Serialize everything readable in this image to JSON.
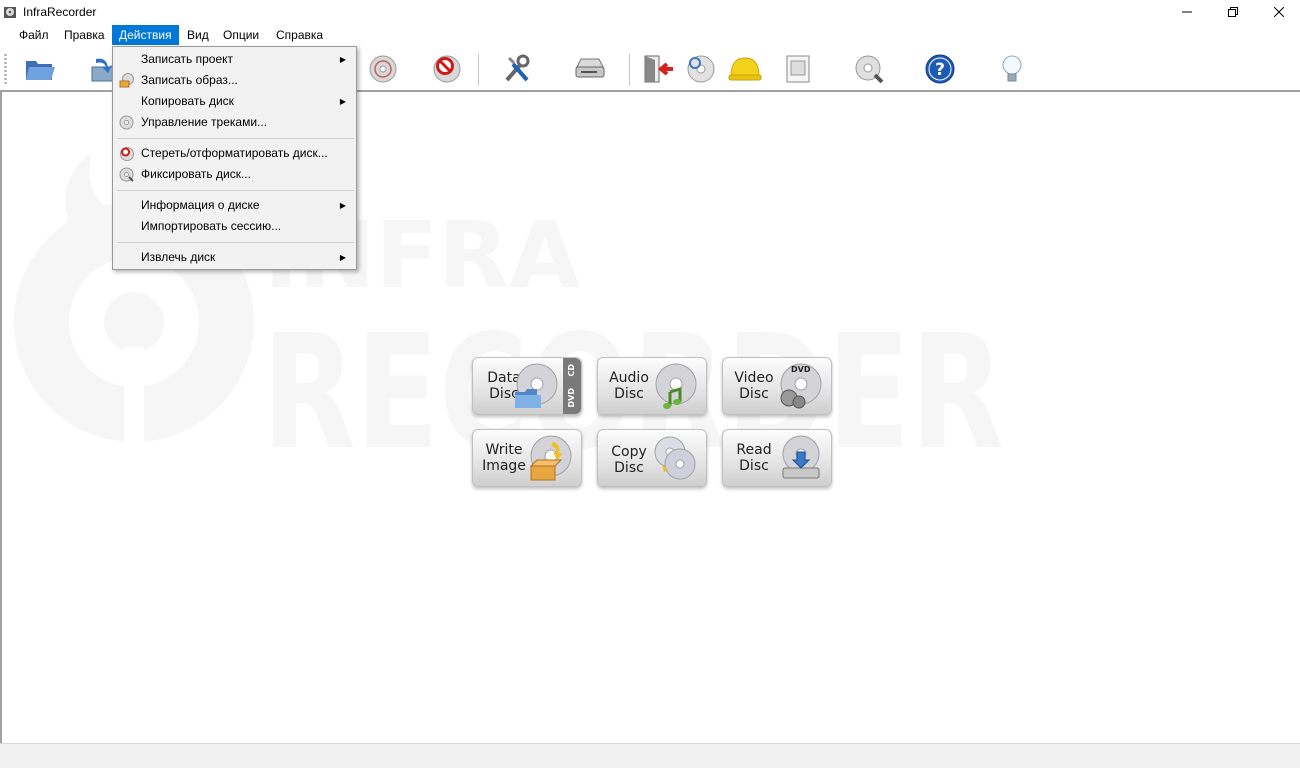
{
  "window": {
    "title": "InfraRecorder",
    "controls": {
      "minimize": "—",
      "maximize": "❐",
      "close": "✕"
    }
  },
  "menubar": {
    "items": [
      {
        "label": "Файл"
      },
      {
        "label": "Правка"
      },
      {
        "label": "Действия"
      },
      {
        "label": "Вид"
      },
      {
        "label": "Опции"
      },
      {
        "label": "Справка"
      }
    ],
    "active_index": 2
  },
  "toolbar": {
    "buttons": [
      {
        "icon": "open-folder-icon"
      },
      {
        "icon": "save-icon"
      },
      {
        "icon": "manage-tracks-icon"
      },
      {
        "icon": "erase-disc-icon"
      },
      {
        "icon": "tools-icon"
      },
      {
        "icon": "drive-icon"
      },
      {
        "icon": "exit-icon"
      },
      {
        "icon": "disc-info-icon"
      },
      {
        "icon": "project-icon"
      },
      {
        "icon": "log-icon"
      },
      {
        "icon": "disc-search-icon"
      },
      {
        "icon": "help-icon"
      },
      {
        "icon": "tip-icon"
      }
    ]
  },
  "actions_menu": {
    "items": [
      {
        "label": "Записать проект",
        "submenu": true,
        "icon": ""
      },
      {
        "label": "Записать образ...",
        "submenu": false,
        "icon": "write-image-icon"
      },
      {
        "label": "Копировать диск",
        "submenu": true,
        "icon": ""
      },
      {
        "label": "Управление треками...",
        "submenu": false,
        "icon": "tracks-icon"
      },
      {
        "label": "Стереть/отформатировать диск...",
        "submenu": false,
        "icon": "erase-icon"
      },
      {
        "label": "Фиксировать диск...",
        "submenu": false,
        "icon": "fixate-icon"
      },
      {
        "label": "Информация о диске",
        "submenu": true,
        "icon": ""
      },
      {
        "label": "Импортировать сессию...",
        "submenu": false,
        "icon": ""
      },
      {
        "label": "Извлечь диск",
        "submenu": true,
        "icon": ""
      }
    ],
    "submenu_arrow": "▶"
  },
  "launcher": {
    "data_disc": {
      "line1": "Data",
      "line2": "Disc",
      "tag_cd": "CD",
      "tag_dvd": "DVD"
    },
    "audio_disc": {
      "line1": "Audio",
      "line2": "Disc"
    },
    "video_disc": {
      "line1": "Video",
      "line2": "Disc",
      "tag": "DVD"
    },
    "write_image": {
      "line1": "Write",
      "line2": "Image"
    },
    "copy_disc": {
      "line1": "Copy",
      "line2": "Disc"
    },
    "read_disc": {
      "line1": "Read",
      "line2": "Disc"
    }
  },
  "watermark": {
    "line1": "INFRA",
    "line2": "RECORDER"
  },
  "colors": {
    "accent": "#0078d7",
    "menu_bg": "#f2f2f2",
    "statusbar_bg": "#f0f0f0"
  }
}
